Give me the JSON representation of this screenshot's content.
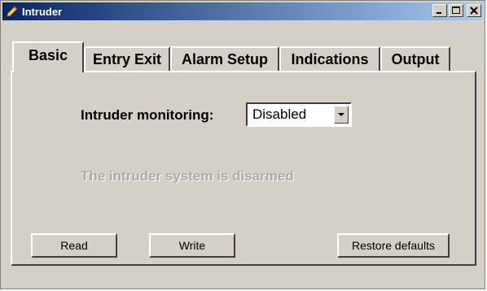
{
  "window": {
    "title": "Intruder",
    "icon": "app-pencil-icon"
  },
  "titlebar_buttons": {
    "minimize": "minimize-icon",
    "maximize": "maximize-icon",
    "close": "close-icon"
  },
  "tabs": [
    {
      "label": "Basic",
      "active": true
    },
    {
      "label": "Entry Exit",
      "active": false
    },
    {
      "label": "Alarm Setup",
      "active": false
    },
    {
      "label": "Indications",
      "active": false
    },
    {
      "label": "Output",
      "active": false
    }
  ],
  "monitoring": {
    "label": "Intruder monitoring:",
    "selected": "Disabled"
  },
  "status": {
    "text": "The intruder system is disarmed"
  },
  "buttons": {
    "read": "Read",
    "write": "Write",
    "restore": "Restore defaults"
  },
  "colors": {
    "title_start": "#0a246a",
    "title_end": "#a6caf0",
    "face": "#d4d0c8",
    "disabled_text": "#a9a9a9"
  }
}
